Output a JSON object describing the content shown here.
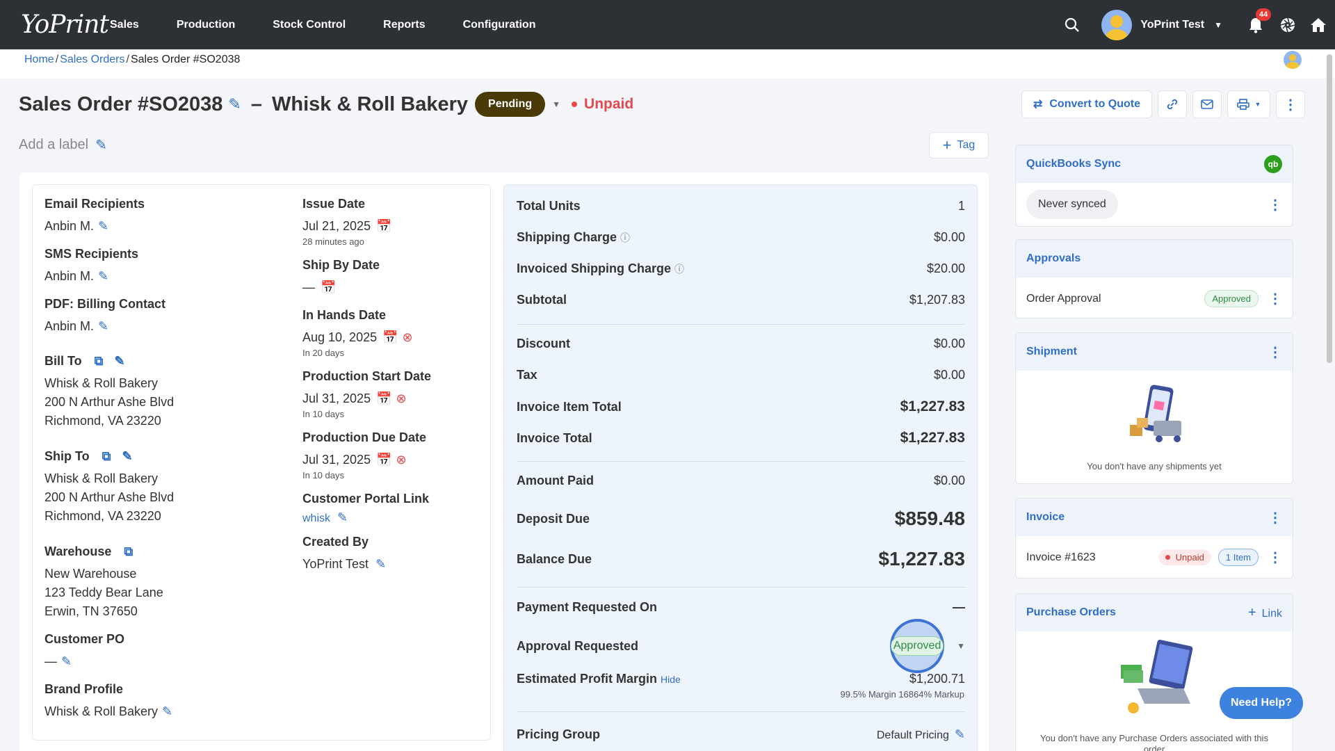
{
  "nav": {
    "logo": "YoPrint",
    "menu": [
      "Sales",
      "Production",
      "Stock Control",
      "Reports",
      "Configuration"
    ],
    "user_name": "YoPrint Test",
    "notification_count": "44"
  },
  "breadcrumb": {
    "home": "Home",
    "sales_orders": "Sales Orders",
    "current": "Sales Order #SO2038"
  },
  "header": {
    "title": "Sales Order #SO2038",
    "dash": "–",
    "customer": "Whisk & Roll Bakery",
    "status": "Pending",
    "payment_status": "Unpaid",
    "convert_label": "Convert to Quote",
    "add_label": "Add a label",
    "tag_label": "Tag"
  },
  "details": {
    "email_label": "Email Recipients",
    "email_value": "Anbin M.",
    "sms_label": "SMS Recipients",
    "sms_value": "Anbin M.",
    "pdf_label": "PDF: Billing Contact",
    "pdf_value": "Anbin M.",
    "bill_to_label": "Bill To",
    "bill_to": [
      "Whisk & Roll Bakery",
      "200 N Arthur Ashe Blvd",
      "Richmond, VA 23220"
    ],
    "ship_to_label": "Ship To",
    "ship_to": [
      "Whisk & Roll Bakery",
      "200 N Arthur Ashe Blvd",
      "Richmond, VA 23220"
    ],
    "warehouse_label": "Warehouse",
    "warehouse": [
      "New Warehouse",
      "123 Teddy Bear Lane",
      "Erwin, TN 37650"
    ],
    "customer_po_label": "Customer PO",
    "customer_po_value": "—",
    "brand_label": "Brand Profile",
    "brand_value": "Whisk & Roll Bakery"
  },
  "dates": {
    "issue_label": "Issue Date",
    "issue_value": "Jul 21, 2025",
    "issue_sub": "28 minutes ago",
    "ship_by_label": "Ship By Date",
    "ship_by_value": "—",
    "in_hands_label": "In Hands Date",
    "in_hands_value": "Aug 10, 2025",
    "in_hands_sub": "In 20 days",
    "prod_start_label": "Production Start Date",
    "prod_start_value": "Jul 31, 2025",
    "prod_start_sub": "In 10 days",
    "prod_due_label": "Production Due Date",
    "prod_due_value": "Jul 31, 2025",
    "prod_due_sub": "In 10 days",
    "portal_label": "Customer Portal Link",
    "portal_value": "whisk",
    "created_label": "Created By",
    "created_value": "YoPrint Test"
  },
  "summary": {
    "total_units_label": "Total Units",
    "total_units": "1",
    "shipping_label": "Shipping Charge",
    "shipping": "$0.00",
    "inv_shipping_label": "Invoiced Shipping Charge",
    "inv_shipping": "$20.00",
    "subtotal_label": "Subtotal",
    "subtotal": "$1,207.83",
    "discount_label": "Discount",
    "discount": "$0.00",
    "tax_label": "Tax",
    "tax": "$0.00",
    "item_total_label": "Invoice Item Total",
    "item_total": "$1,227.83",
    "invoice_total_label": "Invoice Total",
    "invoice_total": "$1,227.83",
    "amount_paid_label": "Amount Paid",
    "amount_paid": "$0.00",
    "deposit_label": "Deposit Due",
    "deposit": "$859.48",
    "balance_label": "Balance Due",
    "balance": "$1,227.83",
    "payment_req_label": "Payment Requested On",
    "payment_req": "—",
    "approval_label": "Approval Requested",
    "approval_value": "Approved",
    "margin_label": "Estimated Profit Margin",
    "margin_hide": "Hide",
    "margin_value": "$1,200.71",
    "margin_sub": "99.5% Margin 16864% Markup",
    "pricing_label": "Pricing Group",
    "pricing_value": "Default Pricing"
  },
  "sidebar": {
    "qb_title": "QuickBooks Sync",
    "qb_status": "Never synced",
    "qb_icon": "qb",
    "approvals_title": "Approvals",
    "approval_item": "Order Approval",
    "approval_badge": "Approved",
    "shipment_title": "Shipment",
    "shipment_empty": "You don't have any shipments yet",
    "invoice_title": "Invoice",
    "invoice_item": "Invoice #1623",
    "invoice_status": "Unpaid",
    "invoice_items": "1 Item",
    "po_title": "Purchase Orders",
    "po_link": "Link",
    "po_empty": "You don't have any Purchase Orders associated with this order"
  },
  "help": "Need Help?",
  "colors": {
    "nav": "#2d3035",
    "accent": "#2f6ec4",
    "pending": "#4a3a08",
    "unpaid": "#e5484d"
  }
}
